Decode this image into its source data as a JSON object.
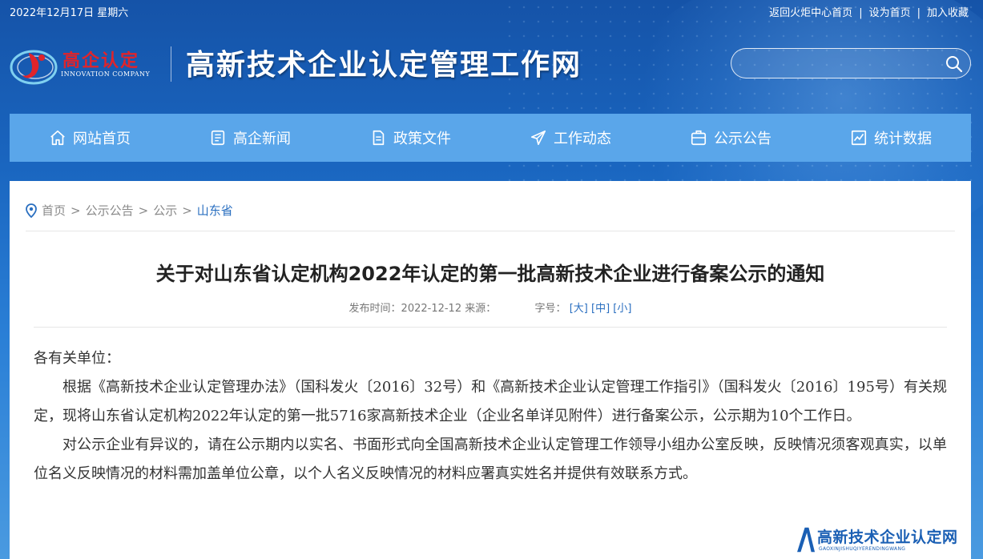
{
  "topbar": {
    "date": "2022年12月17日 星期六",
    "links": [
      "返回火炬中心首页",
      "设为首页",
      "加入收藏"
    ],
    "separator": "|"
  },
  "header": {
    "logo_cn": "高企认定",
    "logo_en": "INNOVATION COMPANY",
    "site_title": "高新技术企业认定管理工作网",
    "search": {
      "placeholder": "",
      "value": ""
    }
  },
  "nav": {
    "items": [
      {
        "label": "网站首页",
        "icon": "home-icon"
      },
      {
        "label": "高企新闻",
        "icon": "news-icon"
      },
      {
        "label": "政策文件",
        "icon": "document-icon"
      },
      {
        "label": "工作动态",
        "icon": "send-icon"
      },
      {
        "label": "公示公告",
        "icon": "notice-icon"
      },
      {
        "label": "统计数据",
        "icon": "chart-icon"
      }
    ],
    "background": "#5aa6ea"
  },
  "breadcrumb": {
    "items": [
      "首页",
      "公示公告",
      "公示"
    ],
    "current": "山东省",
    "separator": ">"
  },
  "article": {
    "title": "关于对山东省认定机构2022年认定的第一批高新技术企业进行备案公示的通知",
    "meta": {
      "publish_label": "发布时间：",
      "publish_date": "2022-12-12",
      "source_label": "来源：",
      "source": "",
      "font_label": "字号：",
      "font_large": "[大]",
      "font_medium": "[中]",
      "font_small": "[小]"
    },
    "paragraphs": [
      "各有关单位：",
      "根据《高新技术企业认定管理办法》（国科发火〔2016〕32号）和《高新技术企业认定管理工作指引》（国科发火〔2016〕195号）有关规定，现将山东省认定机构2022年认定的第一批5716家高新技术企业（企业名单详见附件）进行备案公示，公示期为10个工作日。",
      "对公示企业有异议的，请在公示期内以实名、书面形式向全国高新技术企业认定管理工作领导小组办公室反映，反映情况须客观真实，以单位名义反映情况的材料需加盖单位公章，以个人名义反映情况的材料应署真实姓名并提供有效联系方式。"
    ]
  },
  "watermark": {
    "main": "高新技术企业认定网",
    "sub": "GAOXINJISHUQIYERENDINGWANG"
  },
  "colors": {
    "accent": "#2a6fc0",
    "logo_red": "#e0242b",
    "header_bg": "#1a66c0"
  }
}
